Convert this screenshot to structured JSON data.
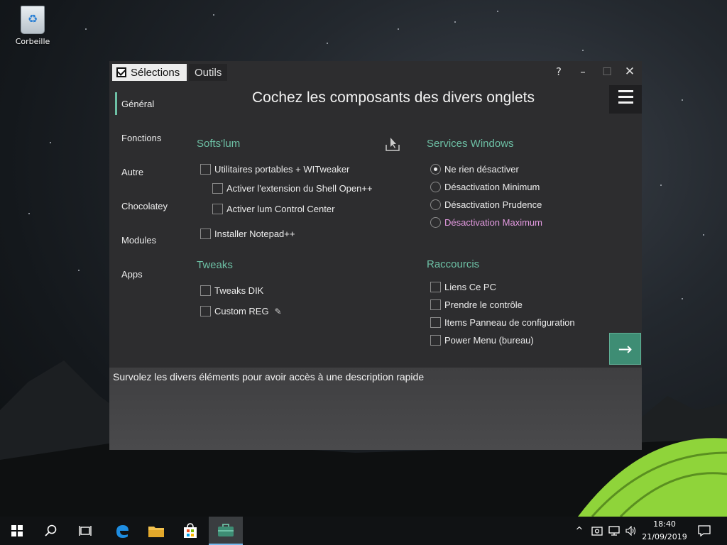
{
  "desktop": {
    "recycle_bin_label": "Corbeille"
  },
  "window": {
    "tabs": {
      "selections": "Sélections",
      "outils": "Outils"
    },
    "controls": {
      "help": "?",
      "minimize": "–",
      "maximize": "☐",
      "close": "✕"
    },
    "sidebar": [
      {
        "label": "Général",
        "active": true
      },
      {
        "label": "Fonctions"
      },
      {
        "label": "Autre"
      },
      {
        "label": "Chocolatey"
      },
      {
        "label": "Modules"
      },
      {
        "label": "Apps"
      }
    ],
    "heading": "Cochez les composants des divers onglets",
    "softslum": {
      "title": "Softs'lum",
      "items": [
        "Utilitaires portables + WITweaker",
        "Activer l'extension du Shell Open++",
        "Activer lum Control Center",
        "Installer Notepad++"
      ]
    },
    "tweaks": {
      "title": "Tweaks",
      "items": [
        "Tweaks DIK",
        "Custom REG"
      ]
    },
    "services": {
      "title": "Services Windows",
      "options": [
        "Ne rien désactiver",
        "Désactivation Minimum",
        "Désactivation Prudence",
        "Désactivation Maximum"
      ],
      "selected": "Ne rien désactiver"
    },
    "raccourcis": {
      "title": "Raccourcis",
      "items": [
        "Liens Ce PC",
        "Prendre le contrôle",
        "Items Panneau de configuration",
        "Power Menu (bureau)"
      ]
    },
    "description": "Survolez les divers éléments pour avoir accès à une description rapide",
    "colors": {
      "accent": "#6dc0a5",
      "highlight": "#e39ae0",
      "next_button": "#3e8d74"
    }
  },
  "taskbar": {
    "time": "18:40",
    "date": "21/09/2019",
    "icons": [
      "windows-start-icon",
      "search-icon",
      "task-view-icon",
      "edge-icon",
      "file-explorer-icon",
      "store-icon",
      "toolbox-app-icon"
    ]
  }
}
